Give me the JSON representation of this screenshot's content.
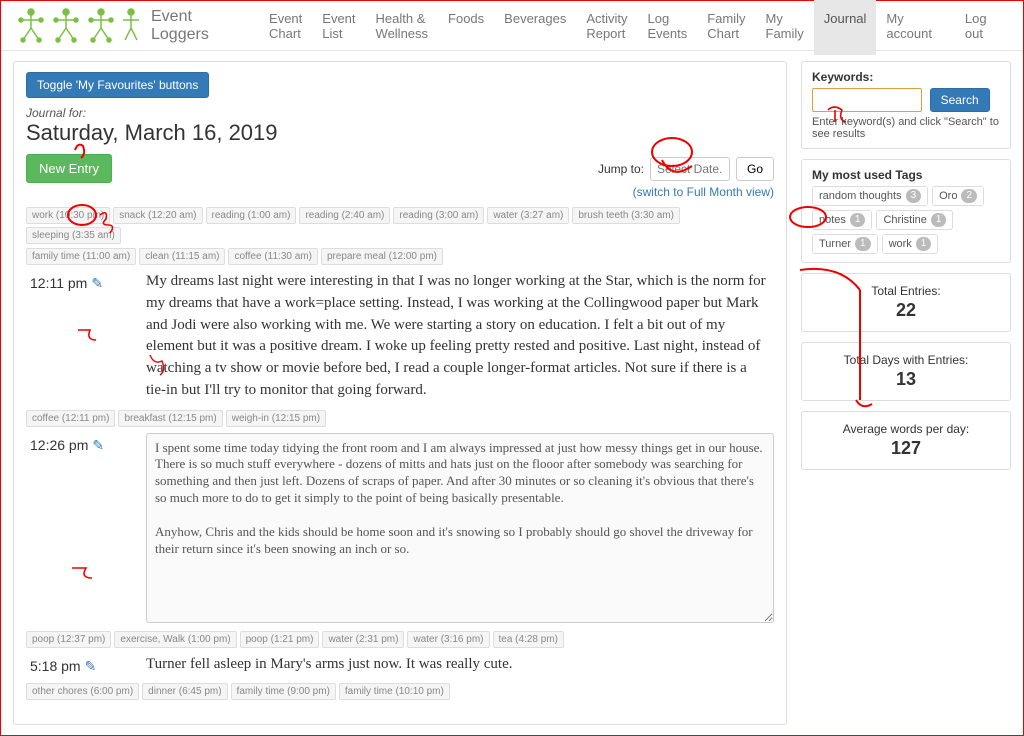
{
  "nav": {
    "brand": "Event Loggers",
    "items": [
      "Event Chart",
      "Event List",
      "Health & Wellness",
      "Foods",
      "Beverages",
      "Activity Report",
      "Log Events",
      "Family Chart",
      "My Family",
      "Journal"
    ],
    "active": "Journal",
    "right": [
      "My account",
      "Log out"
    ]
  },
  "fav_button": "Toggle 'My Favourites' buttons",
  "journal": {
    "for_label": "Journal for:",
    "date": "Saturday, March 16, 2019",
    "new_entry": "New Entry",
    "jump_label": "Jump to:",
    "jump_placeholder": "Select Date...",
    "go": "Go",
    "switch_view": "(switch to Full Month view)"
  },
  "tag_rows": {
    "r1": [
      "work (10:30 pm)",
      "snack (12:20 am)",
      "reading (1:00 am)",
      "reading (2:40 am)",
      "reading (3:00 am)",
      "water (3:27 am)",
      "brush teeth (3:30 am)",
      "sleeping (3:35 am)"
    ],
    "r1b": [
      "family time (11:00 am)",
      "clean (11:15 am)",
      "coffee (11:30 am)",
      "prepare meal (12:00 pm)"
    ],
    "r2": [
      "coffee (12:11 pm)",
      "breakfast (12:15 pm)",
      "weigh-in (12:15 pm)"
    ],
    "r3": [
      "poop (12:37 pm)",
      "exercise, Walk (1:00 pm)",
      "poop (1:21 pm)",
      "water (2:31 pm)",
      "water (3:16 pm)",
      "tea (4:28 pm)"
    ],
    "r4": [
      "other chores (6:00 pm)",
      "dinner (6:45 pm)",
      "family time (9:00 pm)",
      "family time (10:10 pm)"
    ]
  },
  "entries": {
    "e1": {
      "time": "12:11 pm",
      "body": "My dreams last night were interesting in that I was no longer working at the Star, which is the norm for my dreams that have a work=place setting. Instead, I was working at the Collingwood paper but Mark and Jodi were also working with me. We were starting a story on education. I felt a bit out of my element but it was a positive dream. I woke up feeling pretty rested and positive. Last night, instead of watching a tv show or movie before bed, I read a couple longer-format articles. Not sure if there is a tie-in but I'll try to monitor that going forward."
    },
    "e2": {
      "time": "12:26 pm",
      "body": "I spent some time today tidying the front room and I am always impressed at just how messy things get in our house. There is so much stuff everywhere - dozens of mitts and hats just on the flooor after somebody was searching for something and then just left. Dozens of scraps of paper. And after 30 minutes or so cleaning it's obvious that there's so much more to do to get it simply to the point of being basically presentable.\n\nAnyhow, Chris and the kids should be home soon and it's snowing so I probably should go shovel the driveway for their return since it's been snowing an inch or so."
    },
    "e3": {
      "time": "5:18 pm",
      "body": "Turner fell asleep in Mary's arms just now. It was really cute."
    }
  },
  "sidebar": {
    "kw_label": "Keywords:",
    "search": "Search",
    "hint": "Enter keyword(s) and click \"Search\" to see results",
    "tags_label": "My most used Tags",
    "tags": [
      {
        "name": "random thoughts",
        "count": "3"
      },
      {
        "name": "Oro",
        "count": "2"
      },
      {
        "name": "notes",
        "count": "1"
      },
      {
        "name": "Christine",
        "count": "1"
      },
      {
        "name": "Turner",
        "count": "1"
      },
      {
        "name": "work",
        "count": "1"
      }
    ],
    "stats": [
      {
        "label": "Total Entries:",
        "value": "22"
      },
      {
        "label": "Total Days with Entries:",
        "value": "13"
      },
      {
        "label": "Average words per day:",
        "value": "127"
      }
    ]
  }
}
